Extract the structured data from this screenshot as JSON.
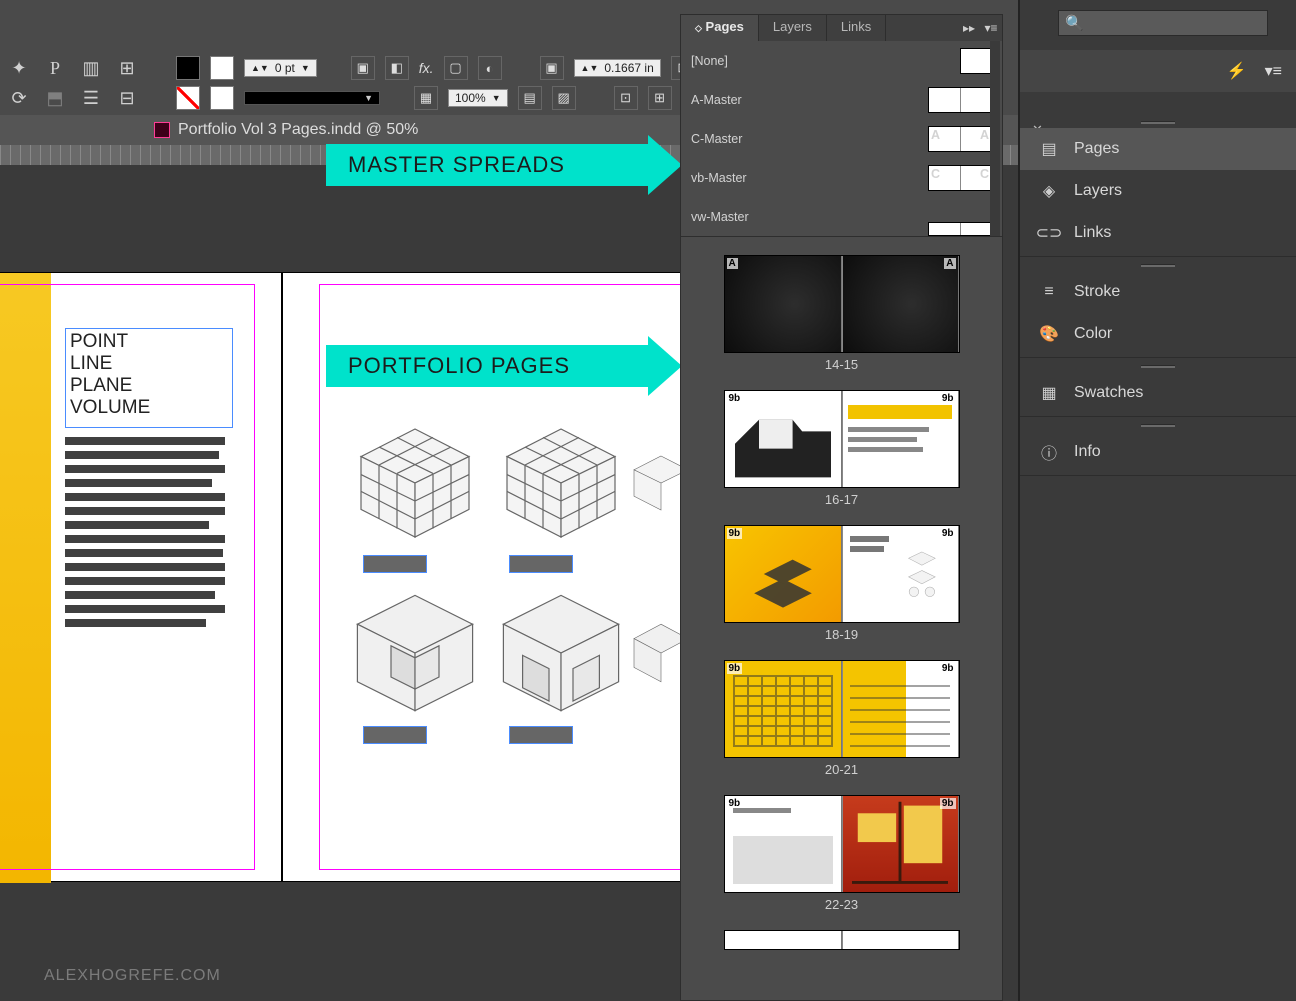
{
  "doc_title": "Portfolio Vol 3 Pages.indd @ 50%",
  "control_bar": {
    "stroke_weight": "0 pt",
    "zoom": "100%",
    "measure": "0.1667 in",
    "fx_label": "fx."
  },
  "annotations": {
    "masters": "MASTER SPREADS",
    "pages": "PORTFOLIO PAGES"
  },
  "text_frame": {
    "l1": "POINT",
    "l2": "LINE",
    "l3": "PLANE",
    "l4": "VOLUME"
  },
  "pages_panel": {
    "tabs": {
      "pages": "Pages",
      "layers": "Layers",
      "links": "Links"
    },
    "masters": {
      "none": "[None]",
      "a": "A-Master",
      "c": "C-Master",
      "vb": "vb-Master",
      "vw": "vw-Master"
    },
    "spreads": {
      "s1": {
        "label": "14-15",
        "lp": "A",
        "rp": "A"
      },
      "s2": {
        "label": "16-17",
        "lp": "9b",
        "rp": "9b"
      },
      "s3": {
        "label": "18-19",
        "lp": "9b",
        "rp": "9b"
      },
      "s4": {
        "label": "20-21",
        "lp": "9b",
        "rp": "9b"
      },
      "s5": {
        "label": "22-23",
        "lp": "9b",
        "rp": "9b"
      }
    }
  },
  "right_rail": {
    "search_placeholder": "",
    "panels": {
      "pages": "Pages",
      "layers": "Layers",
      "links": "Links",
      "stroke": "Stroke",
      "color": "Color",
      "swatches": "Swatches",
      "info": "Info"
    }
  },
  "watermark": "ALEXHOGREFE.COM"
}
